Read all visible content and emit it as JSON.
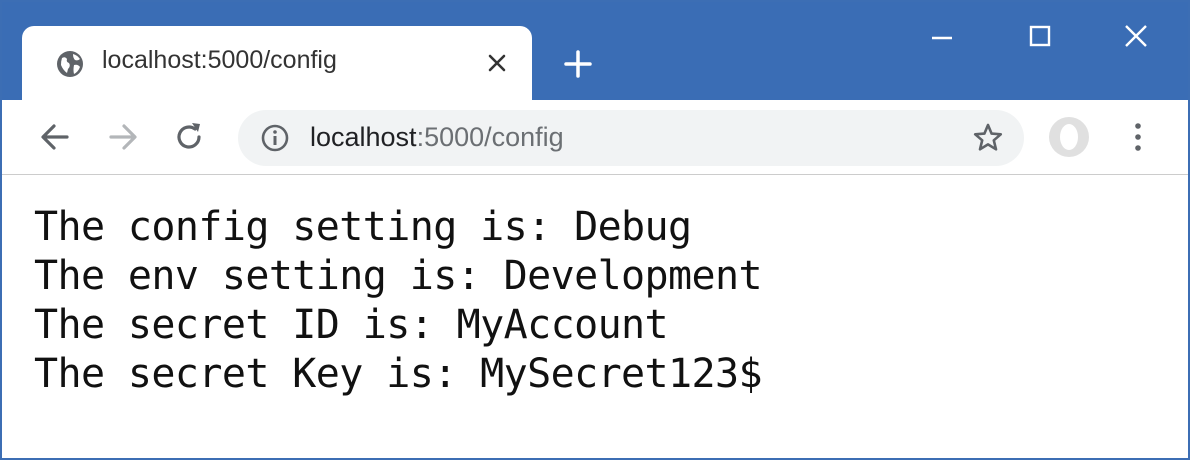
{
  "window": {
    "title_bar_color": "#3a6db5",
    "controls": {
      "minimize_icon": "minimize-icon",
      "maximize_icon": "maximize-icon",
      "close_icon": "close-icon"
    }
  },
  "tab": {
    "title": "localhost:5000/config",
    "favicon": "globe-icon",
    "close_icon": "close-icon"
  },
  "new_tab_icon": "plus-icon",
  "toolbar": {
    "back_icon": "back-arrow-icon",
    "forward_icon": "forward-arrow-icon",
    "reload_icon": "reload-icon",
    "address": {
      "host": "localhost",
      "rest": ":5000/config",
      "info_icon": "info-icon",
      "star_icon": "star-icon"
    },
    "profile_icon": "avatar-icon",
    "menu_icon": "kebab-menu-icon"
  },
  "page": {
    "lines": [
      "The config setting is: Debug",
      "The env setting is: Development",
      "The secret ID is: MyAccount",
      "The secret Key is: MySecret123$"
    ]
  }
}
